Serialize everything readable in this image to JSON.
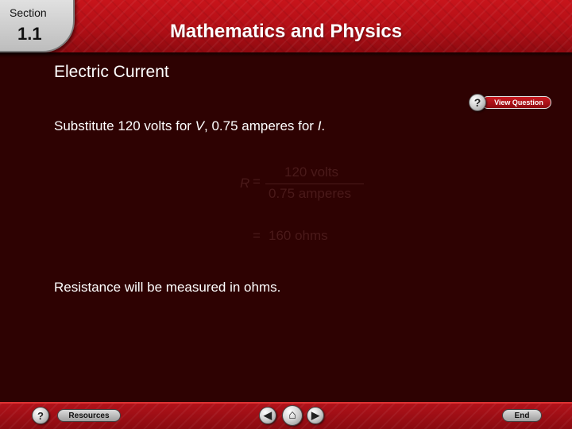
{
  "header": {
    "section_label": "Section",
    "section_number": "1.1",
    "title": "Mathematics and Physics"
  },
  "content": {
    "topic": "Electric Current",
    "instruction_parts": [
      "Substitute 120 volts for ",
      "V",
      ", 0.75 amperes for ",
      "I",
      "."
    ],
    "equation": {
      "lhs": "R",
      "equals": "=",
      "numerator": "120 volts",
      "denominator": "0.75 amperes",
      "result": "160 ohms"
    },
    "closing": "Resistance will be measured in ohms."
  },
  "buttons": {
    "view_question": "View Question",
    "help_glyph": "?",
    "resources": "Resources",
    "end": "End",
    "prev_glyph": "◀",
    "home_glyph": "⌂",
    "next_glyph": "▶"
  },
  "colors": {
    "background": "#2e0202",
    "header_red": "#c8141b",
    "faint_equation": "#4a1a1a"
  },
  "icons": [
    "help-icon",
    "previous-icon",
    "home-icon",
    "next-icon"
  ]
}
